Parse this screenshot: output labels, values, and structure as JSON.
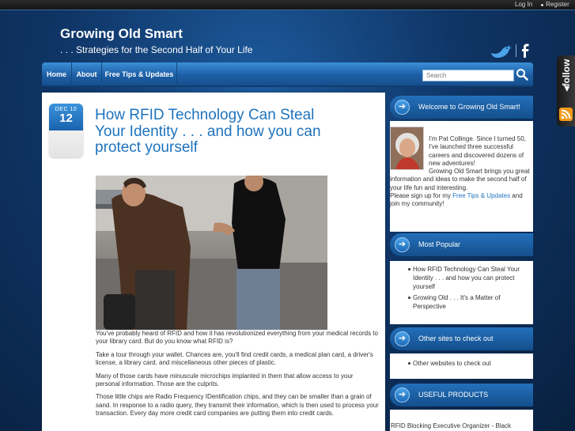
{
  "topbar": {
    "login": "Log In",
    "register": "Register"
  },
  "header": {
    "title": "Growing Old Smart",
    "tagline": ". . . Strategies for the Second Half of Your Life"
  },
  "nav": {
    "items": [
      "Home",
      "About",
      "Free Tips & Updates"
    ],
    "search_placeholder": "Search"
  },
  "follow": {
    "label": "follow"
  },
  "post": {
    "date_month": "DEC 10",
    "date_day": "12",
    "title": "How RFID Technology Can Steal Your Identity . . . and how you can protect yourself",
    "paragraphs": [
      "You've probably heard of  RFID and how it has revolutionized everything from your medical records to your library card. But do you know what RFID is?",
      "Take a tour through your wallet. Chances are, you'll find credit cards, a medical plan card, a driver's license, a library card, and miscellaneous other pieces of  plastic.",
      "Many of those cards have minuscule microchips implanted in them that allow access to your personal information. Those are the culprits.",
      "Those little chips are Radio Frequency IDentification chips, and they can be smaller than a grain of sand. In response to a radio query, they transmit their information, which is then used to process your transaction. Every day more credit card companies are putting them into credit cards."
    ]
  },
  "sidebar": {
    "welcome": {
      "title": "Welcome to Growing Old Smart!",
      "text_1": "I'm Pat Collinge. Since I turned 50, I've launched three successful careers and discovered dozens of new adventures!",
      "text_2": "Growing Old Smart brings you great information and ideas to make the second half of your life fun and interesting.",
      "text_3_pre": "Please sign up for my ",
      "text_3_link": "Free Tips & Updates",
      "text_3_post": " and join my community!"
    },
    "popular": {
      "title": "Most Popular",
      "items": [
        "How RFID Technology Can Steal Your Identity . . . and how you can protect yourself",
        "Growing Old . . . It's a Matter of Perspective"
      ]
    },
    "other_sites": {
      "title": "Other sites to check out",
      "items": [
        "Other websites to check out"
      ]
    },
    "products": {
      "title": "USEFUL PRODUCTS",
      "first_item": "RFID Blocking Executive Organizer - Black"
    }
  },
  "colors": {
    "link_blue": "#1e73be",
    "nav_blue": "#1d5fa6",
    "background_navy": "#0f3566",
    "twitter_blue": "#4aa3ea"
  },
  "icons": [
    "search-icon",
    "twitter-icon",
    "facebook-icon",
    "rss-icon",
    "arrow-right-icon"
  ]
}
